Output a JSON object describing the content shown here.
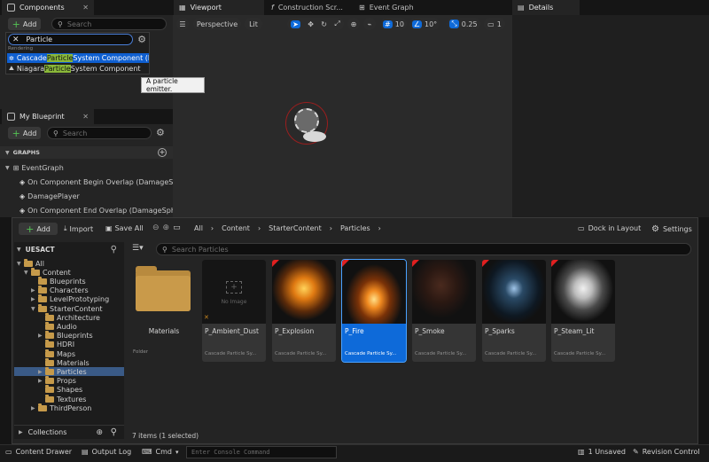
{
  "components": {
    "tab_label": "Components",
    "add_label": "Add",
    "search_placeholder": "Search",
    "filter_value": "Particle",
    "section": "Rendering",
    "results": [
      {
        "pre": "Cascade ",
        "hl": "Particle",
        "post": " System Component (l"
      },
      {
        "pre": "Niagara ",
        "hl": "Particle",
        "post": " System Component"
      }
    ],
    "tooltip": "A particle emitter."
  },
  "blueprint": {
    "tab_label": "My Blueprint",
    "add_label": "Add",
    "search_placeholder": "Search",
    "graphs_label": "GRAPHS",
    "event_graph": "EventGraph",
    "events": [
      "On Component Begin Overlap (DamageSph",
      "DamagePlayer",
      "On Component End Overlap (DamageSpher"
    ]
  },
  "tabs": {
    "viewport": "Viewport",
    "construction": "Construction Scr...",
    "event_graph": "Event Graph",
    "details": "Details"
  },
  "viewport": {
    "perspective": "Perspective",
    "lit": "Lit",
    "grid_snap": "10",
    "rot_snap": "10°",
    "scale_snap": "0.25",
    "cam_speed": "1"
  },
  "browser": {
    "add_label": "Add",
    "import_label": "Import",
    "save_all_label": "Save All",
    "breadcrumb": [
      "All",
      "Content",
      "StarterContent",
      "Particles"
    ],
    "dock_label": "Dock in Layout",
    "settings_label": "Settings",
    "root_label": "UESACT",
    "search_placeholder": "Search Particles",
    "collections_label": "Collections",
    "status": "7 items (1 selected)",
    "tree": [
      {
        "label": "All",
        "depth": 0,
        "open": true
      },
      {
        "label": "Content",
        "depth": 1,
        "open": true
      },
      {
        "label": "Blueprints",
        "depth": 2,
        "open": false,
        "leaf": true
      },
      {
        "label": "Characters",
        "depth": 2,
        "open": false
      },
      {
        "label": "LevelPrototyping",
        "depth": 2,
        "open": false
      },
      {
        "label": "StarterContent",
        "depth": 2,
        "open": true
      },
      {
        "label": "Architecture",
        "depth": 3,
        "leaf": true
      },
      {
        "label": "Audio",
        "depth": 3,
        "leaf": true
      },
      {
        "label": "Blueprints",
        "depth": 3,
        "open": false
      },
      {
        "label": "HDRI",
        "depth": 3,
        "leaf": true
      },
      {
        "label": "Maps",
        "depth": 3,
        "leaf": true
      },
      {
        "label": "Materials",
        "depth": 3,
        "leaf": true
      },
      {
        "label": "Particles",
        "depth": 3,
        "open": false,
        "selected": true
      },
      {
        "label": "Props",
        "depth": 3,
        "open": false
      },
      {
        "label": "Shapes",
        "depth": 3,
        "leaf": true
      },
      {
        "label": "Textures",
        "depth": 3,
        "leaf": true
      },
      {
        "label": "ThirdPerson",
        "depth": 2,
        "open": false
      }
    ],
    "folder_item": {
      "name": "Materials",
      "type": "Folder"
    },
    "assets": [
      {
        "name": "P_Ambient_Dust",
        "type": "Cascade Particle Sy...",
        "thumb": "noimage",
        "noimage_text": "No Image"
      },
      {
        "name": "P_Explosion",
        "type": "Cascade Particle Sy...",
        "thumb": "explosion"
      },
      {
        "name": "P_Fire",
        "type": "Cascade Particle Sy...",
        "thumb": "fire",
        "selected": true
      },
      {
        "name": "P_Smoke",
        "type": "Cascade Particle Sy...",
        "thumb": "smoke"
      },
      {
        "name": "P_Sparks",
        "type": "Cascade Particle Sy...",
        "thumb": "sparks"
      },
      {
        "name": "P_Steam_Lit",
        "type": "Cascade Particle Sy...",
        "thumb": "steam"
      }
    ]
  },
  "statusbar": {
    "content_drawer": "Content Drawer",
    "output_log": "Output Log",
    "cmd": "Cmd",
    "console_placeholder": "Enter Console Command",
    "unsaved": "1 Unsaved",
    "revision": "Revision Control"
  }
}
